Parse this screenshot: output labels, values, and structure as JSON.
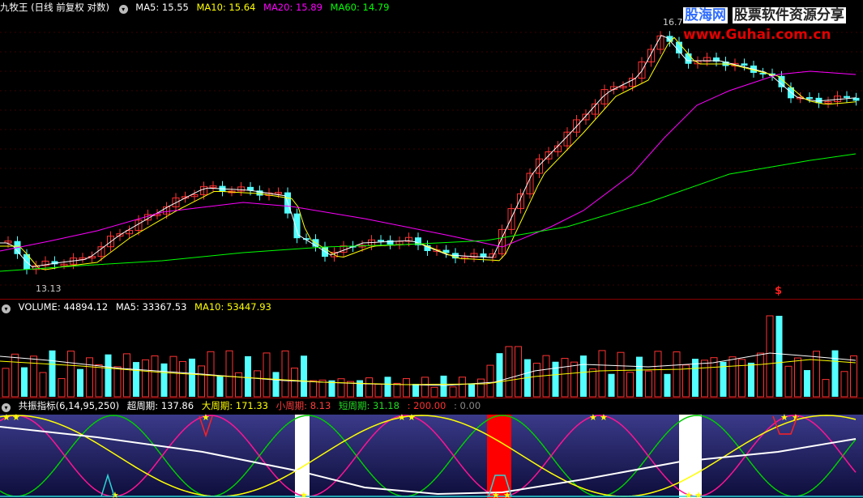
{
  "main": {
    "title": "九牧王 (日线 前复权 对数)",
    "ma5": "MA5: 15.55",
    "ma10": "MA10: 15.64",
    "ma20": "MA20: 15.89",
    "ma60": "MA60: 14.79",
    "high_label": "16.7",
    "low_label": "13.13",
    "marker": "$",
    "colors": {
      "ma5": "#ffffff",
      "ma10": "#ffff00",
      "ma20": "#ff00ff",
      "ma60": "#00ff00",
      "up": "#ff3232",
      "down": "#54ffff"
    }
  },
  "volume": {
    "label": "VOLUME: 44894.12",
    "ma5": "MA5: 33367.53",
    "ma10": "MA10: 53447.93"
  },
  "indicator": {
    "name": "共振指标(6,14,95,250)",
    "super": "超周期: 137.86",
    "big": "大周期: 171.33",
    "small": "小周期: 8.13",
    "short": "短周期: 31.18",
    "v1": ": 200.00",
    "v2": ": 0.00"
  },
  "logo": {
    "brand": "股海网",
    "slogan": "股票软件资源分享",
    "url": "www.Guhai.com.cn"
  }
}
